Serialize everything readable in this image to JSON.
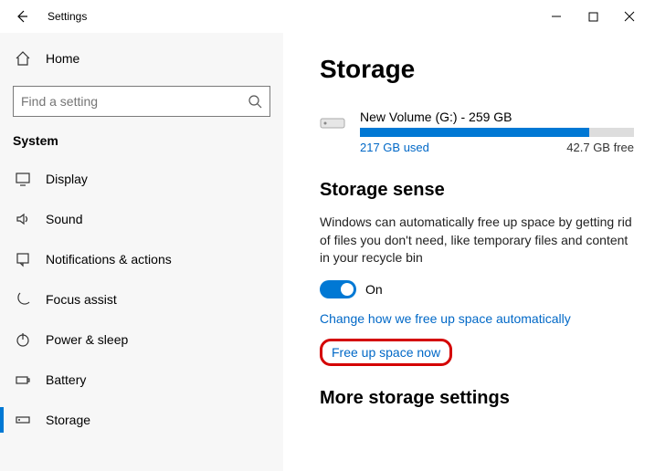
{
  "titlebar": {
    "title": "Settings"
  },
  "sidebar": {
    "home": "Home",
    "search_placeholder": "Find a setting",
    "category": "System",
    "items": [
      {
        "label": "Display"
      },
      {
        "label": "Sound"
      },
      {
        "label": "Notifications & actions"
      },
      {
        "label": "Focus assist"
      },
      {
        "label": "Power & sleep"
      },
      {
        "label": "Battery"
      },
      {
        "label": "Storage"
      }
    ]
  },
  "content": {
    "page_title": "Storage",
    "drive": {
      "name": "New Volume (G:) - 259 GB",
      "used": "217 GB used",
      "free": "42.7 GB free",
      "used_pct": 83.8
    },
    "storage_sense": {
      "title": "Storage sense",
      "description": "Windows can automatically free up space by getting rid of files you don't need, like temporary files and content in your recycle bin",
      "toggle_label": "On",
      "link_change": "Change how we free up space automatically",
      "link_free": "Free up space now"
    },
    "more_title": "More storage settings"
  }
}
